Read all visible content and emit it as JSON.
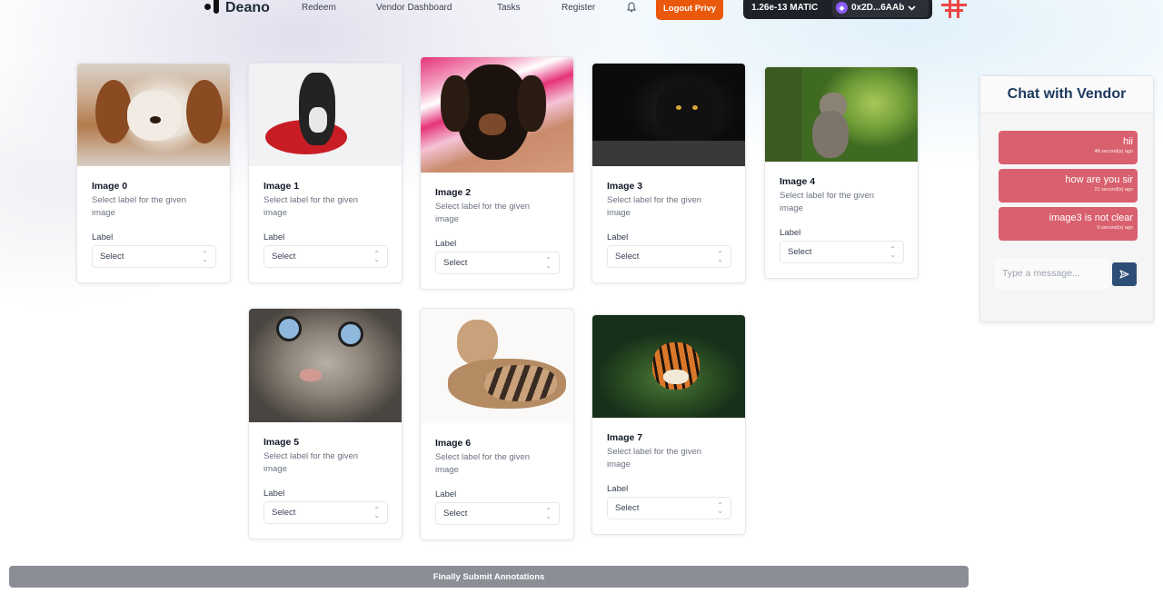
{
  "nav": {
    "brand": "Deano",
    "links": [
      "Redeem",
      "Vendor Dashboard",
      "Tasks",
      "Register"
    ],
    "logout_label": "Logout Privy",
    "wallet_balance": "1.26e-13 MATIC",
    "wallet_address": "0x2D...6AAb"
  },
  "cards": [
    {
      "title": "Image 0",
      "description": "Select label for the given image",
      "label": "Label",
      "select": "Select"
    },
    {
      "title": "Image 1",
      "description": "Select label for the given image",
      "label": "Label",
      "select": "Select"
    },
    {
      "title": "Image 2",
      "description": "Select label for the given image",
      "label": "Label",
      "select": "Select"
    },
    {
      "title": "Image 3",
      "description": "Select label for the given image",
      "label": "Label",
      "select": "Select"
    },
    {
      "title": "Image 4",
      "description": "Select label for the given image",
      "label": "Label",
      "select": "Select"
    },
    {
      "title": "Image 5",
      "description": "Select label for the given image",
      "label": "Label",
      "select": "Select"
    },
    {
      "title": "Image 6",
      "description": "Select label for the given image",
      "label": "Label",
      "select": "Select"
    },
    {
      "title": "Image 7",
      "description": "Select label for the given image",
      "label": "Label",
      "select": "Select"
    }
  ],
  "chat": {
    "title": "Chat with Vendor",
    "messages": [
      {
        "text": "hii",
        "time": "48 second(s) ago"
      },
      {
        "text": "how are you sir",
        "time": "21 second(s) ago"
      },
      {
        "text": "image3 is not clear",
        "time": "0 second(s) ago"
      }
    ],
    "input_placeholder": "Type a message..."
  },
  "submit_label": "Finally Submit Annotations",
  "colors": {
    "accent_orange": "#ea580c",
    "chat_bubble": "#d9606e",
    "chat_title": "#1e3a5f",
    "send_button": "#2c4e74",
    "submit_button": "#8b8e95"
  }
}
